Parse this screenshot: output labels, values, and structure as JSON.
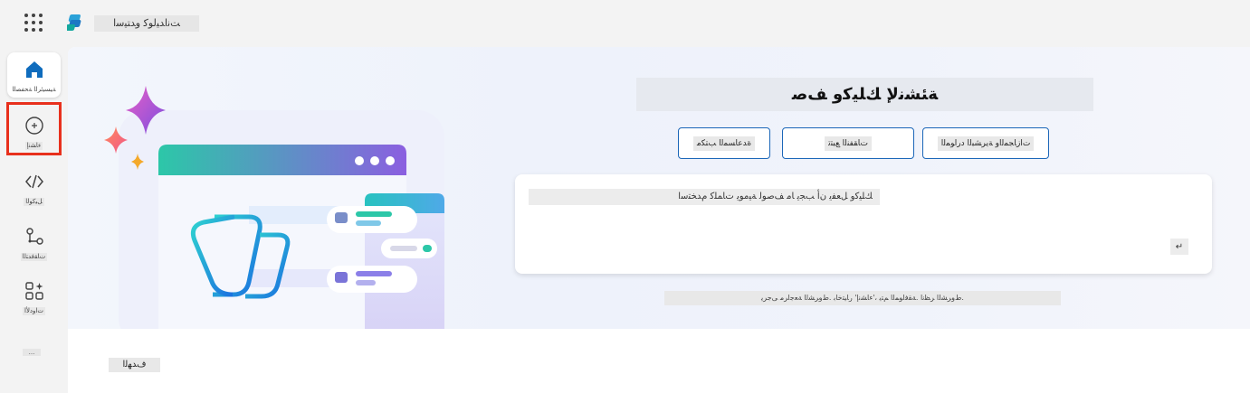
{
  "header": {
    "app_title": "ﺖﻧﺍﺪﻴﻟﻮﻛ ﻭﺪﺘﻴﺳﺍ"
  },
  "rail": {
    "home_label": "ﺔﻴﺴﻴﺋﺮﻟﺍ ﺔﺤﻔﺼﻟﺍ",
    "create_label": "ﺀﺎﺸﻧﺇ",
    "code_label": "ﻞﻴﻛﻮﻟﺍ",
    "flows_label": "ﺕﺎﻘﻓﺪﺘﻟﺍ",
    "apps_label": "ﺕﺍﻭﺩﻷﺍ",
    "more_label": "..."
  },
  "hero": {
    "heading": "ﺔﺌﺸﻧﻹ ﻚﻠﻴﻛﻭ ﻒﺻ",
    "chips": [
      "ﺕﺍﺯﺎﺠﻤﻟﺍﻭ ﺔﻳﺮﺸﺒﻟﺍ ﺩﺭﺍﻮﻤﻟﺍ",
      "ﺕﺎﻘﻔﻨﻟﺍ ﻊﺒﺘﺗ",
      "ﺓﺪﻋﺎﺴﻤﻟﺍ ﺐﺘﻜﻣ"
    ],
    "prompt_value": "ﻚﻠﻴﻛﻭ ﻞﻌﻔﻳ ﻥﺃ ﺐﺠﻳ ﺎﻣ ﻒﺻﻮﻟ ﺔﻴﻣﻮﻳ ﺕﺎﻤﻠﻛ ﻡﺪﺨﺘﺳﺍ",
    "send_label": "↵",
    "disclaimer": ".ﻁﻭﺮﺸﻟﺍ ﺮﻈﻧﺍ .ﺔﻘﻓﺍﻮﻤﻟﺍ ﻢﺘﻳ ،'ﺀﺎﺸﻧﺇ' ﺭﺎﻴﺘﺧﺎﺑ .ﻁﻭﺮﺸﻟﺍ ﺔﻌﺟﺍﺮﻣ ﻰﺟﺮﻳ"
  },
  "lower": {
    "learn_label": "ﻑﺪﻬﻟﺍ"
  },
  "icons": {
    "apps_launcher": "waffle-icon",
    "home": "home-icon",
    "create": "add-circle-icon",
    "code": "code-icon",
    "flows": "flow-icon",
    "tools": "apps-sparkle-icon"
  },
  "colors": {
    "accent": "#1b66b8",
    "highlight": "#e8301c"
  }
}
